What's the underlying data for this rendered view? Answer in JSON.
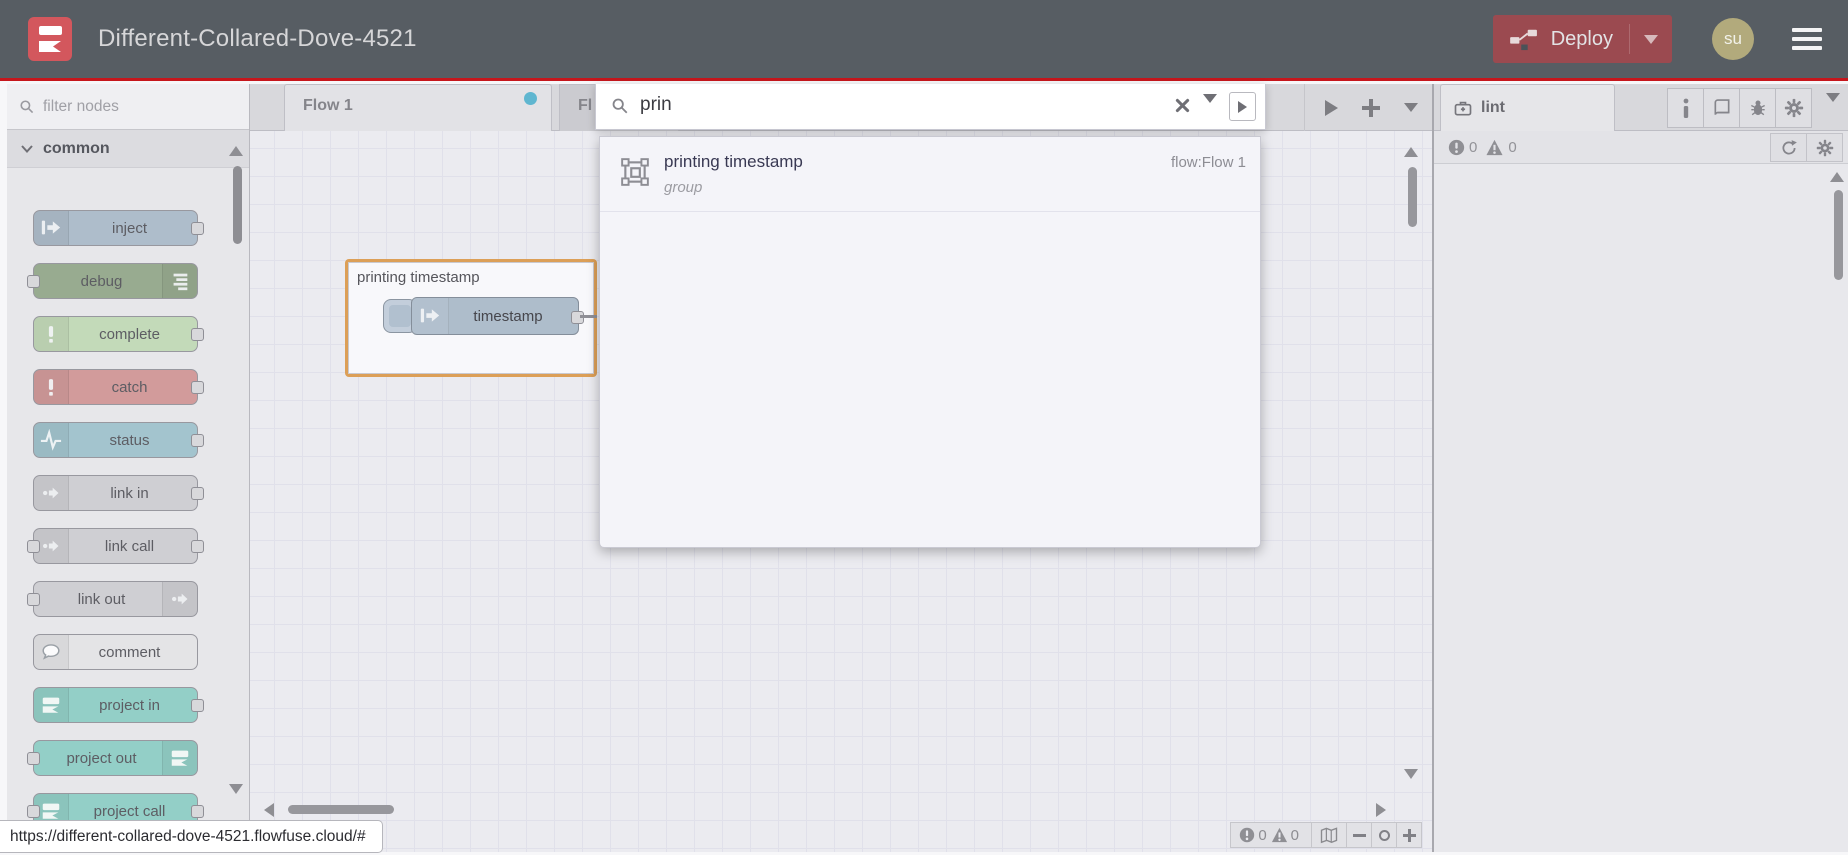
{
  "header": {
    "title": "Different-Collared-Dove-4521",
    "deploy_label": "Deploy",
    "avatar_initials": "su"
  },
  "palette": {
    "filter_placeholder": "filter nodes",
    "category": "common",
    "nodes": [
      {
        "label": "inject",
        "color": "#aebdcb",
        "icon": "arrow",
        "icon_side": "left",
        "ports": "right"
      },
      {
        "label": "debug",
        "color": "#98ab90",
        "icon": "lines",
        "icon_side": "right",
        "ports": "left"
      },
      {
        "label": "complete",
        "color": "#c3dab9",
        "icon": "exclaim",
        "icon_side": "left",
        "ports": "right"
      },
      {
        "label": "catch",
        "color": "#d29b9b",
        "icon": "exclaim",
        "icon_side": "left",
        "ports": "right"
      },
      {
        "label": "status",
        "color": "#a3c4ce",
        "icon": "pulse",
        "icon_side": "left",
        "ports": "right"
      },
      {
        "label": "link in",
        "color": "#cfcfd3",
        "icon": "link",
        "icon_side": "left",
        "ports": "right"
      },
      {
        "label": "link call",
        "color": "#cfcfd3",
        "icon": "link",
        "icon_side": "left",
        "ports": "both"
      },
      {
        "label": "link out",
        "color": "#cfcfd3",
        "icon": "link",
        "icon_side": "right",
        "ports": "left"
      },
      {
        "label": "comment",
        "color": "#e4e4e6",
        "icon": "bubble",
        "icon_side": "left",
        "ports": "none"
      },
      {
        "label": "project in",
        "color": "#93cfc7",
        "icon": "ff",
        "icon_side": "left",
        "ports": "right"
      },
      {
        "label": "project out",
        "color": "#93cfc7",
        "icon": "ff",
        "icon_side": "right",
        "ports": "left"
      },
      {
        "label": "project call",
        "color": "#93cfc7",
        "icon": "ff",
        "icon_side": "left",
        "ports": "both"
      }
    ]
  },
  "workspace": {
    "tabs": [
      {
        "label": "Flow 1",
        "active": true,
        "unsaved_dot": true
      },
      {
        "label": "Fl",
        "active": false
      }
    ],
    "group_label": "printing timestamp",
    "node_label": "timestamp",
    "status": {
      "errors": "0",
      "warnings": "0"
    },
    "url_tooltip": "https://different-collared-dove-4521.flowfuse.cloud/#"
  },
  "search": {
    "query": "prin",
    "results": [
      {
        "title": "printing timestamp",
        "subtitle": "group",
        "location": "flow:Flow 1"
      }
    ]
  },
  "sidebar": {
    "tab_label": "lint",
    "counts": {
      "errors": "0",
      "warnings": "0"
    }
  },
  "colors": {
    "header_bg": "#575d63",
    "accent_red_line": "#c6161c",
    "deploy_button": "#9b4a50",
    "unsaved_dot": "#5fb6d0",
    "group_selection": "#dc9f57"
  }
}
